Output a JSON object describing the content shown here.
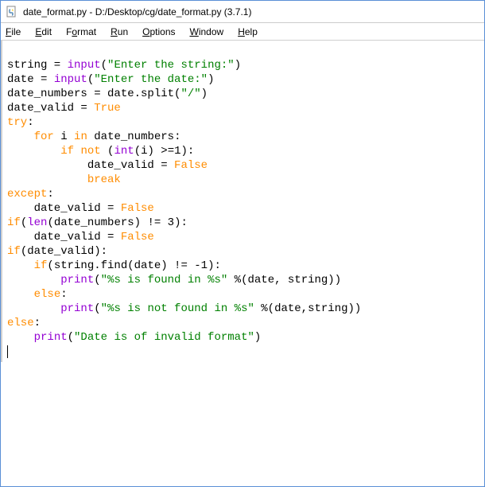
{
  "window": {
    "title": "date_format.py - D:/Desktop/cg/date_format.py (3.7.1)"
  },
  "menu": {
    "file": "File",
    "edit": "Edit",
    "format": "Format",
    "run": "Run",
    "options": "Options",
    "window": "Window",
    "help": "Help"
  },
  "code": {
    "l1a": "string = ",
    "l1b": "input",
    "l1c": "(",
    "l1d": "\"Enter the string:\"",
    "l1e": ")",
    "l2a": "date = ",
    "l2b": "input",
    "l2c": "(",
    "l2d": "\"Enter the date:\"",
    "l2e": ")",
    "l3a": "date_numbers = date.split(",
    "l3b": "\"/\"",
    "l3c": ")",
    "l4a": "date_valid = ",
    "l4b": "True",
    "l5a": "try",
    "l5b": ":",
    "l6a": "    ",
    "l6b": "for",
    "l6c": " i ",
    "l6d": "in",
    "l6e": " date_numbers:",
    "l7a": "        ",
    "l7b": "if",
    "l7c": " ",
    "l7d": "not",
    "l7e": " (",
    "l7f": "int",
    "l7g": "(i) >=",
    "l7h": "1",
    "l7i": "):",
    "l8a": "            date_valid = ",
    "l8b": "False",
    "l9a": "            ",
    "l9b": "break",
    "l10a": "except",
    "l10b": ":",
    "l11a": "    date_valid = ",
    "l11b": "False",
    "l12a": "if",
    "l12b": "(",
    "l12c": "len",
    "l12d": "(date_numbers) != ",
    "l12e": "3",
    "l12f": "):",
    "l13a": "    date_valid = ",
    "l13b": "False",
    "l14a": "if",
    "l14b": "(date_valid):",
    "l15a": "    ",
    "l15b": "if",
    "l15c": "(string.find(date) != -",
    "l15d": "1",
    "l15e": "):",
    "l16a": "        ",
    "l16b": "print",
    "l16c": "(",
    "l16d": "\"%s is found in %s\"",
    "l16e": " %(date, string))",
    "l17a": "    ",
    "l17b": "else",
    "l17c": ":",
    "l18a": "        ",
    "l18b": "print",
    "l18c": "(",
    "l18d": "\"%s is not found in %s\"",
    "l18e": " %(date,string))",
    "l19a": "else",
    "l19b": ":",
    "l20a": "    ",
    "l20b": "print",
    "l20c": "(",
    "l20d": "\"Date is of invalid format\"",
    "l20e": ")"
  }
}
